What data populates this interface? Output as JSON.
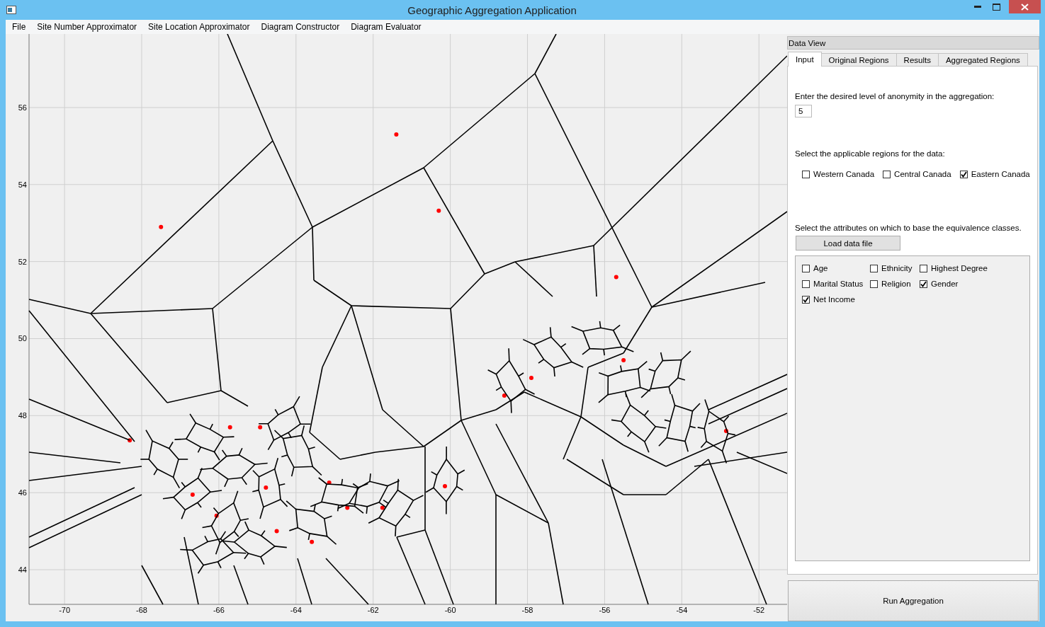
{
  "window": {
    "title": "Geographic Aggregation Application"
  },
  "menu": [
    "File",
    "Site Number Approximator",
    "Site Location Approximator",
    "Diagram Constructor",
    "Diagram Evaluator"
  ],
  "plot": {
    "chart_data": {
      "type": "scatter",
      "grid": true,
      "xlim": [
        -70.92,
        -51.27
      ],
      "ylim": [
        43.1,
        57.91
      ],
      "xticks": [
        -70,
        -68,
        -66,
        -64,
        -62,
        -60,
        -58,
        -56,
        -54,
        -52
      ],
      "yticks": [
        44,
        46,
        48,
        50,
        52,
        54,
        56
      ],
      "x": [
        -68.31,
        -66.68,
        -66.06,
        -65.71,
        -64.93,
        -64.78,
        -63.59,
        -63.14,
        -62.67,
        -61.76,
        -60.14,
        -58.6,
        -57.9,
        -55.51,
        -52.85,
        -61.4,
        -67.5,
        -60.3,
        -55.7,
        -64.5
      ],
      "values": [
        47.36,
        45.95,
        45.4,
        47.7,
        47.7,
        46.13,
        44.72,
        46.26,
        45.61,
        45.61,
        46.17,
        48.52,
        48.98,
        49.44,
        47.6,
        55.3,
        52.9,
        53.32,
        51.6,
        45.0
      ]
    }
  },
  "data_view": {
    "title": "Data View",
    "tabs": [
      {
        "label": "Input",
        "selected": true
      },
      {
        "label": "Original Regions",
        "selected": false
      },
      {
        "label": "Results",
        "selected": false
      },
      {
        "label": "Aggregated Regions",
        "selected": false
      }
    ],
    "anonymity": {
      "label": "Enter the desired level of anonymity in the aggregation:",
      "value": "5"
    },
    "regions": {
      "label": "Select the applicable regions for the data:",
      "options": [
        {
          "label": "Western Canada",
          "checked": false
        },
        {
          "label": "Central Canada",
          "checked": false
        },
        {
          "label": "Eastern Canada",
          "checked": true
        }
      ]
    },
    "attributes": {
      "label": "Select the attributes on which to base the equivalence classes.",
      "load_button": "Load data file",
      "options": [
        {
          "label": "Age",
          "checked": false
        },
        {
          "label": "Ethnicity",
          "checked": false
        },
        {
          "label": "Highest Degree",
          "checked": false
        },
        {
          "label": "Marital Status",
          "checked": false
        },
        {
          "label": "Religion",
          "checked": false
        },
        {
          "label": "Gender",
          "checked": true
        },
        {
          "label": "Net Income",
          "checked": true
        }
      ]
    }
  },
  "run_button": "Run Aggregation"
}
